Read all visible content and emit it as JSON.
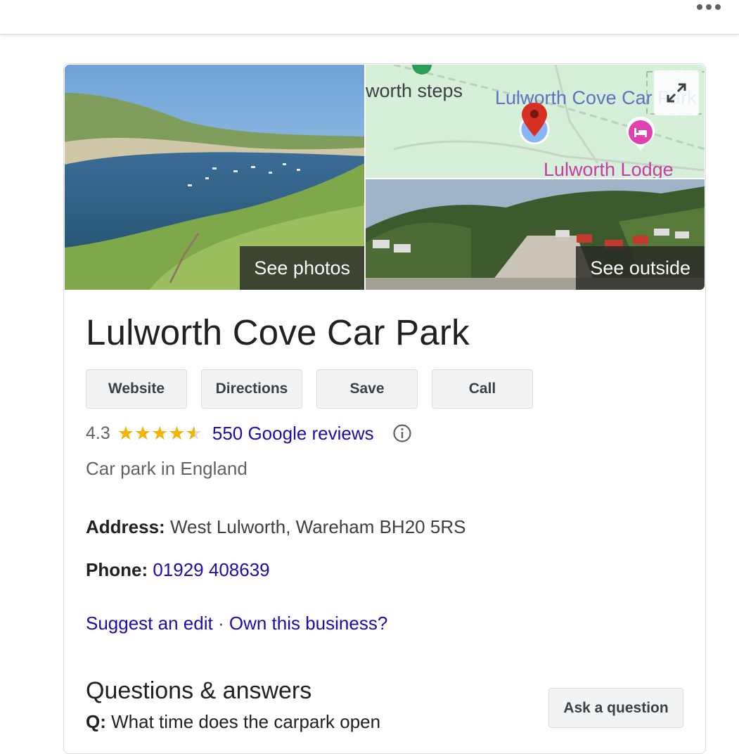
{
  "place": {
    "title": "Lulworth Cove Car Park",
    "category": "Car park in England"
  },
  "media": {
    "see_photos_label": "See photos",
    "see_outside_label": "See outside",
    "map_labels": {
      "trail": "worth steps",
      "car_park": "Lulworth Cove Car Park",
      "lodge": "Lulworth Lodge"
    }
  },
  "actions": [
    {
      "label": "Website"
    },
    {
      "label": "Directions"
    },
    {
      "label": "Save"
    },
    {
      "label": "Call"
    }
  ],
  "rating": {
    "value": "4.3",
    "stars_filled": 4.3,
    "stars_total": 5,
    "reviews_label": "550 Google reviews"
  },
  "address": {
    "label": "Address:",
    "value": "West Lulworth, Wareham BH20 5RS"
  },
  "phone": {
    "label": "Phone:",
    "value": "01929 408639"
  },
  "edit_links": {
    "suggest": "Suggest an edit",
    "separator": "·",
    "own": "Own this business?"
  },
  "qa": {
    "title": "Questions & answers",
    "ask_label": "Ask a question",
    "question_prefix": "Q:",
    "question_text": "What time does the carpark open"
  },
  "colors": {
    "link": "#1a0dab",
    "star": "#f5b301",
    "map_green": "#d6efd9",
    "pin_red": "#d93025",
    "lodge_pink": "#e040b0"
  },
  "icons": [
    "more-options-icon",
    "expand-map-icon",
    "map-pin-icon",
    "hotel-pin-icon",
    "info-icon",
    "star-icon"
  ]
}
